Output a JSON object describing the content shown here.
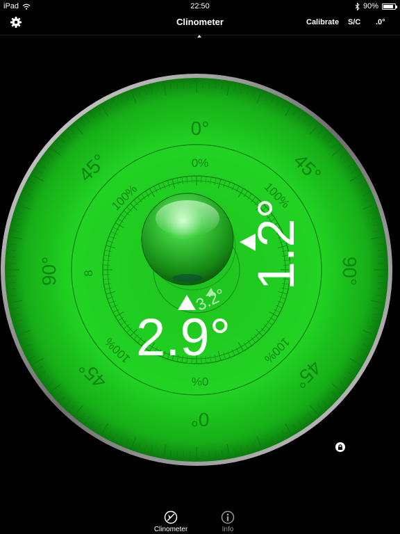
{
  "status_bar": {
    "device": "iPad",
    "time": "22:50",
    "battery": "90%",
    "battery_level": 0.9
  },
  "nav": {
    "title": "Clinometer",
    "buttons": [
      "Calibrate",
      "S/C",
      ".0°"
    ]
  },
  "dial": {
    "outer_labels": {
      "top": "0°",
      "bottom": "0°",
      "left": "90°",
      "right": "90°",
      "corners": "45°"
    },
    "inner_labels": {
      "top": "0%",
      "bottom": "0%",
      "left": "8",
      "percent": "100%"
    }
  },
  "readouts": {
    "vertical_angle": "1.2°",
    "horizontal_angle": "2.9°",
    "total_angle": "3.2°"
  },
  "colors": {
    "face": "#19d11a",
    "face_dark": "#0a7a0d",
    "text": "#ffffff"
  },
  "tabs": [
    {
      "label": "Clinometer",
      "icon": "clinometer-icon"
    },
    {
      "label": "Info",
      "icon": "info-icon"
    }
  ]
}
